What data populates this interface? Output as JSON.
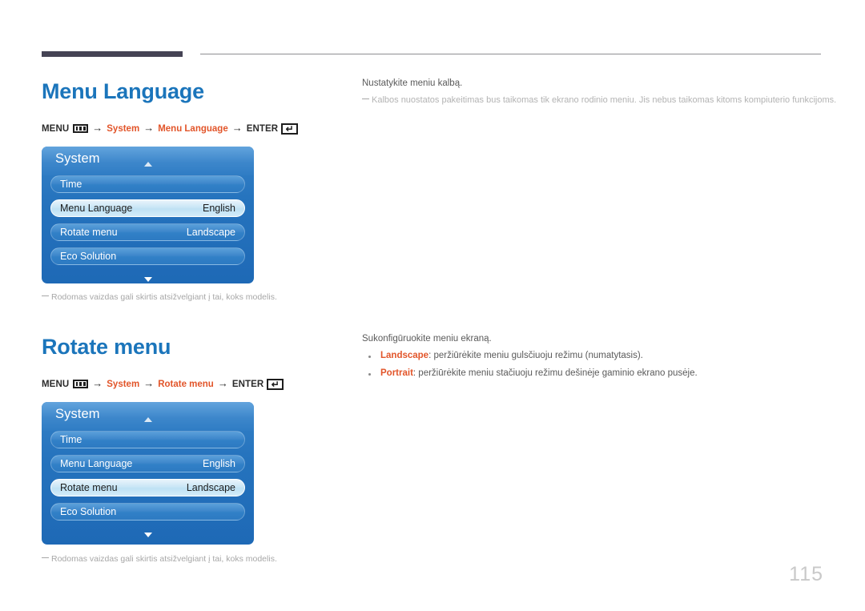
{
  "page": {
    "number": "115",
    "language_note_dash": "—"
  },
  "sections": [
    {
      "id": "menu-language",
      "heading": "Menu Language",
      "path": {
        "menu_label": "MENU",
        "menu_icon": "menu-bars-icon",
        "arrow": "→",
        "crumb1": "System",
        "crumb2": "Menu Language",
        "enter_label": "ENTER",
        "enter_icon": "return-key-icon",
        "enter_glyph": "↵"
      },
      "osd": {
        "title": "System",
        "scroll_up_icon": "caret-up-icon",
        "scroll_down_icon": "caret-down-icon",
        "rows": [
          {
            "label": "Time",
            "value": "",
            "selected": false
          },
          {
            "label": "Menu Language",
            "value": "English",
            "selected": true
          },
          {
            "label": "Rotate menu",
            "value": "Landscape",
            "selected": false
          },
          {
            "label": "Eco Solution",
            "value": "",
            "selected": false
          }
        ]
      },
      "footnote": "Rodomas vaizdas gali skirtis atsižvelgiant į tai, koks modelis.",
      "right": {
        "lead": "Nustatykite meniu kalbą.",
        "note": "Kalbos nuostatos pakeitimas bus taikomas tik ekrano rodinio meniu. Jis nebus taikomas kitoms kompiuterio funkcijoms.",
        "bullets": []
      }
    },
    {
      "id": "rotate-menu",
      "heading": "Rotate menu",
      "path": {
        "menu_label": "MENU",
        "menu_icon": "menu-bars-icon",
        "arrow": "→",
        "crumb1": "System",
        "crumb2": "Rotate menu",
        "enter_label": "ENTER",
        "enter_icon": "return-key-icon",
        "enter_glyph": "↵"
      },
      "osd": {
        "title": "System",
        "scroll_up_icon": "caret-up-icon",
        "scroll_down_icon": "caret-down-icon",
        "rows": [
          {
            "label": "Time",
            "value": "",
            "selected": false
          },
          {
            "label": "Menu Language",
            "value": "English",
            "selected": false
          },
          {
            "label": "Rotate menu",
            "value": "Landscape",
            "selected": true
          },
          {
            "label": "Eco Solution",
            "value": "",
            "selected": false
          }
        ]
      },
      "footnote": "Rodomas vaizdas gali skirtis atsižvelgiant į tai, koks modelis.",
      "right": {
        "lead": "Sukonfigūruokite meniu ekraną.",
        "note": "",
        "bullets": [
          {
            "term": "Landscape",
            "text": ": peržiūrėkite meniu gulsčiuoju režimu (numatytasis)."
          },
          {
            "term": "Portrait",
            "text": ": peržiūrėkite meniu stačiuoju režimu dešinėje gaminio ekrano pusėje."
          }
        ]
      }
    }
  ],
  "colors": {
    "heading_blue": "#1b75bb",
    "accent_orange": "#e2552a",
    "rule_dark": "#454354",
    "osd_blue": "#2573bd",
    "osd_selected": "#c9e6f6",
    "page_number_gray": "#c9c9c9"
  }
}
